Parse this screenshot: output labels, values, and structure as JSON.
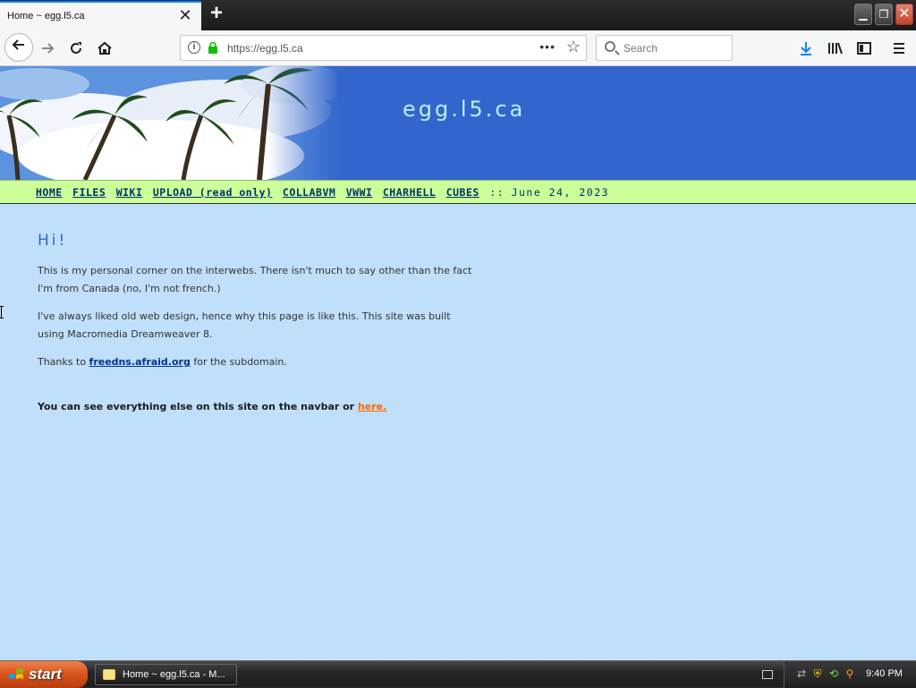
{
  "browser": {
    "tab_title": "Home ~ egg.l5.ca",
    "url": "https://egg.l5.ca",
    "search_placeholder": "Search"
  },
  "site": {
    "title": "egg.l5.ca",
    "nav": {
      "links": [
        "HOME",
        "FILES",
        "WIKI",
        "UPLOAD (read only)",
        "COLLABVM",
        "VWWI",
        "CHARHELL",
        "CUBES"
      ],
      "separator": "::",
      "date": "June 24, 2023"
    },
    "heading": "Hi!",
    "para1": "This is my personal corner on the interwebs. There isn't much to say other than the fact I'm from Canada (no, I'm not french.)",
    "para2": "I've always liked old web design, hence why this page is like this. This site was built using Macromedia Dreamweaver 8.",
    "para3_before": "Thanks to ",
    "para3_link": "freedns.afraid.org",
    "para3_after": " for the subdomain.",
    "footer_text": "You can see everything else on this site on the navbar or ",
    "footer_link": "here."
  },
  "taskbar": {
    "start_label": "start",
    "task_label": "Home ~ egg.l5.ca - M...",
    "clock": "9:40 PM"
  }
}
